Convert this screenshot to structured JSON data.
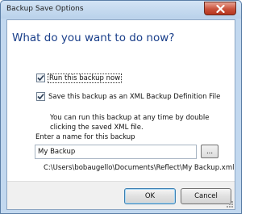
{
  "window": {
    "title": "Backup Save Options"
  },
  "dialog": {
    "heading": "What do you want to do now?",
    "options": [
      {
        "label": "Run this backup now",
        "checked": true
      },
      {
        "label": "Save this backup as an XML Backup Definition File",
        "checked": true
      }
    ],
    "description_lines": [
      "You can run this backup at any time by double",
      "clicking the saved XML file."
    ],
    "name_label": "Enter a name for this backup",
    "name_value": "My Backup",
    "browse_label": "...",
    "path": "C:\\Users\\bobaugello\\Documents\\Reflect\\My Backup.xml"
  },
  "buttons": {
    "ok": "OK",
    "cancel": "Cancel"
  },
  "colors": {
    "heading": "#1a3f8a",
    "frame": "#c2d8ef",
    "close": "#c9513a"
  },
  "icons": {
    "close": "close-icon",
    "check": "checkmark-icon",
    "grip": "resize-grip-icon"
  }
}
